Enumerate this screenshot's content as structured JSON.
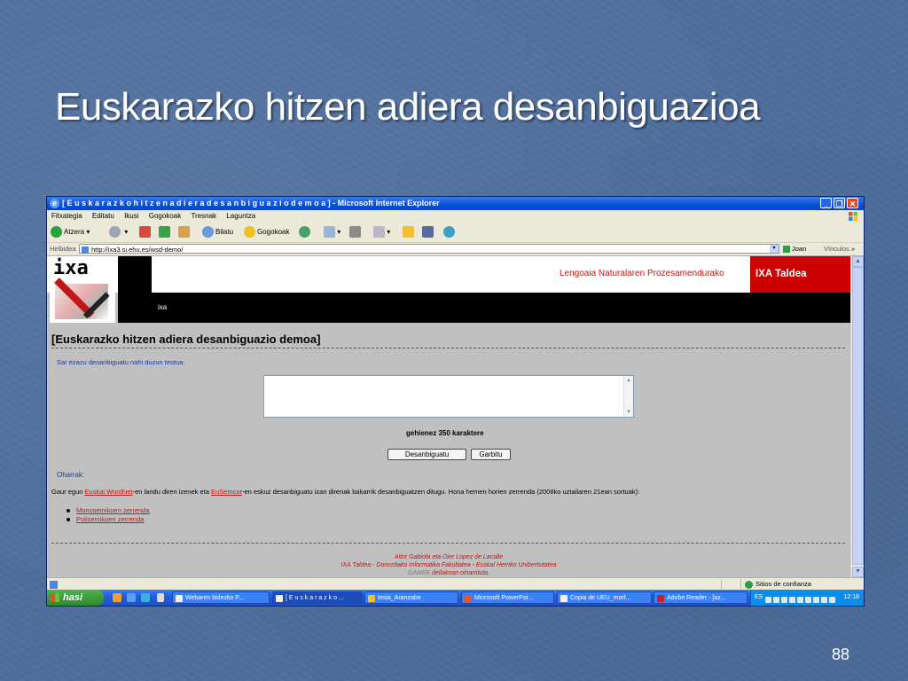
{
  "slide": {
    "title": "Euskarazko hitzen adiera desanbiguazioa",
    "page_number": "88"
  },
  "window": {
    "title": "[ E u s k a r a z k o   h i t z e n   a d i e r a   d e s a n b i g u a z i o   d e m o a ] - Microsoft Internet Explorer",
    "minimize": "_",
    "maximize": "❐",
    "close": "✕"
  },
  "menu": [
    "Fitxategia",
    "Editatu",
    "Ikusi",
    "Gogokoak",
    "Tresnak",
    "Laguntza"
  ],
  "toolbar": {
    "back": "Atzera",
    "search": "Bilatu",
    "favorites": "Gogokoak"
  },
  "address": {
    "label": "Helbidea",
    "url": "http://ixa3.si.ehu.es/wsd-demo/",
    "go": "Joan",
    "links": "Vínculos",
    "more": "»"
  },
  "header": {
    "logo_text": "ixa",
    "link": "ixa",
    "lingua": "Lengoaia Naturalaren Prozesamendurako",
    "group": "IXA Taldea"
  },
  "content": {
    "heading": "[Euskarazko hitzen adiera desanbiguazio demoa]",
    "prompt": "Sar ezazu desanbiguatu nahi duzun testua:",
    "limit": "gehienez 350 karaktere",
    "button_disambiguate": "Desanbiguatu",
    "button_clear": "Garbitu",
    "notes_label": "Oharrak:",
    "desc_part1": "Gaur egun ",
    "desc_link1": "Euskal WordNet",
    "desc_part2": "-en landu diren izenek eta ",
    "desc_link2": "EuSemcor",
    "desc_part3": "-en eskuz desanbiguatu izan direnak bakarrik desanbiguatzen ditugu. Hona hemen horien zerrenda (2008ko uztailaren 21ean sortuak):",
    "list": [
      "Monosemikoen zerrenda",
      "Polisemikoen zerrenda"
    ],
    "footer_line1": "Aitor Gabiola eta Oier Lopez de Lacalle",
    "footer_line2": "IXA Taldea - Donostiako Informatika Fakultatea - Euskal Herriko Unibertsitatea",
    "footer_link": "GAMEK",
    "footer_line3": " dellakoan oinarrituta."
  },
  "statusbar": {
    "zone": "Sitios de confianza"
  },
  "taskbar": {
    "start": "hasi",
    "tasks": [
      "Webaren bidezko P...",
      "[ E u s k a r a z k o ...",
      "tesia_Aranzabe",
      "Microsoft PowerPoi...",
      "Copia de UEU_morf...",
      "Adobe Reader - [az..."
    ],
    "lang": "ES",
    "clock": "12:18"
  }
}
